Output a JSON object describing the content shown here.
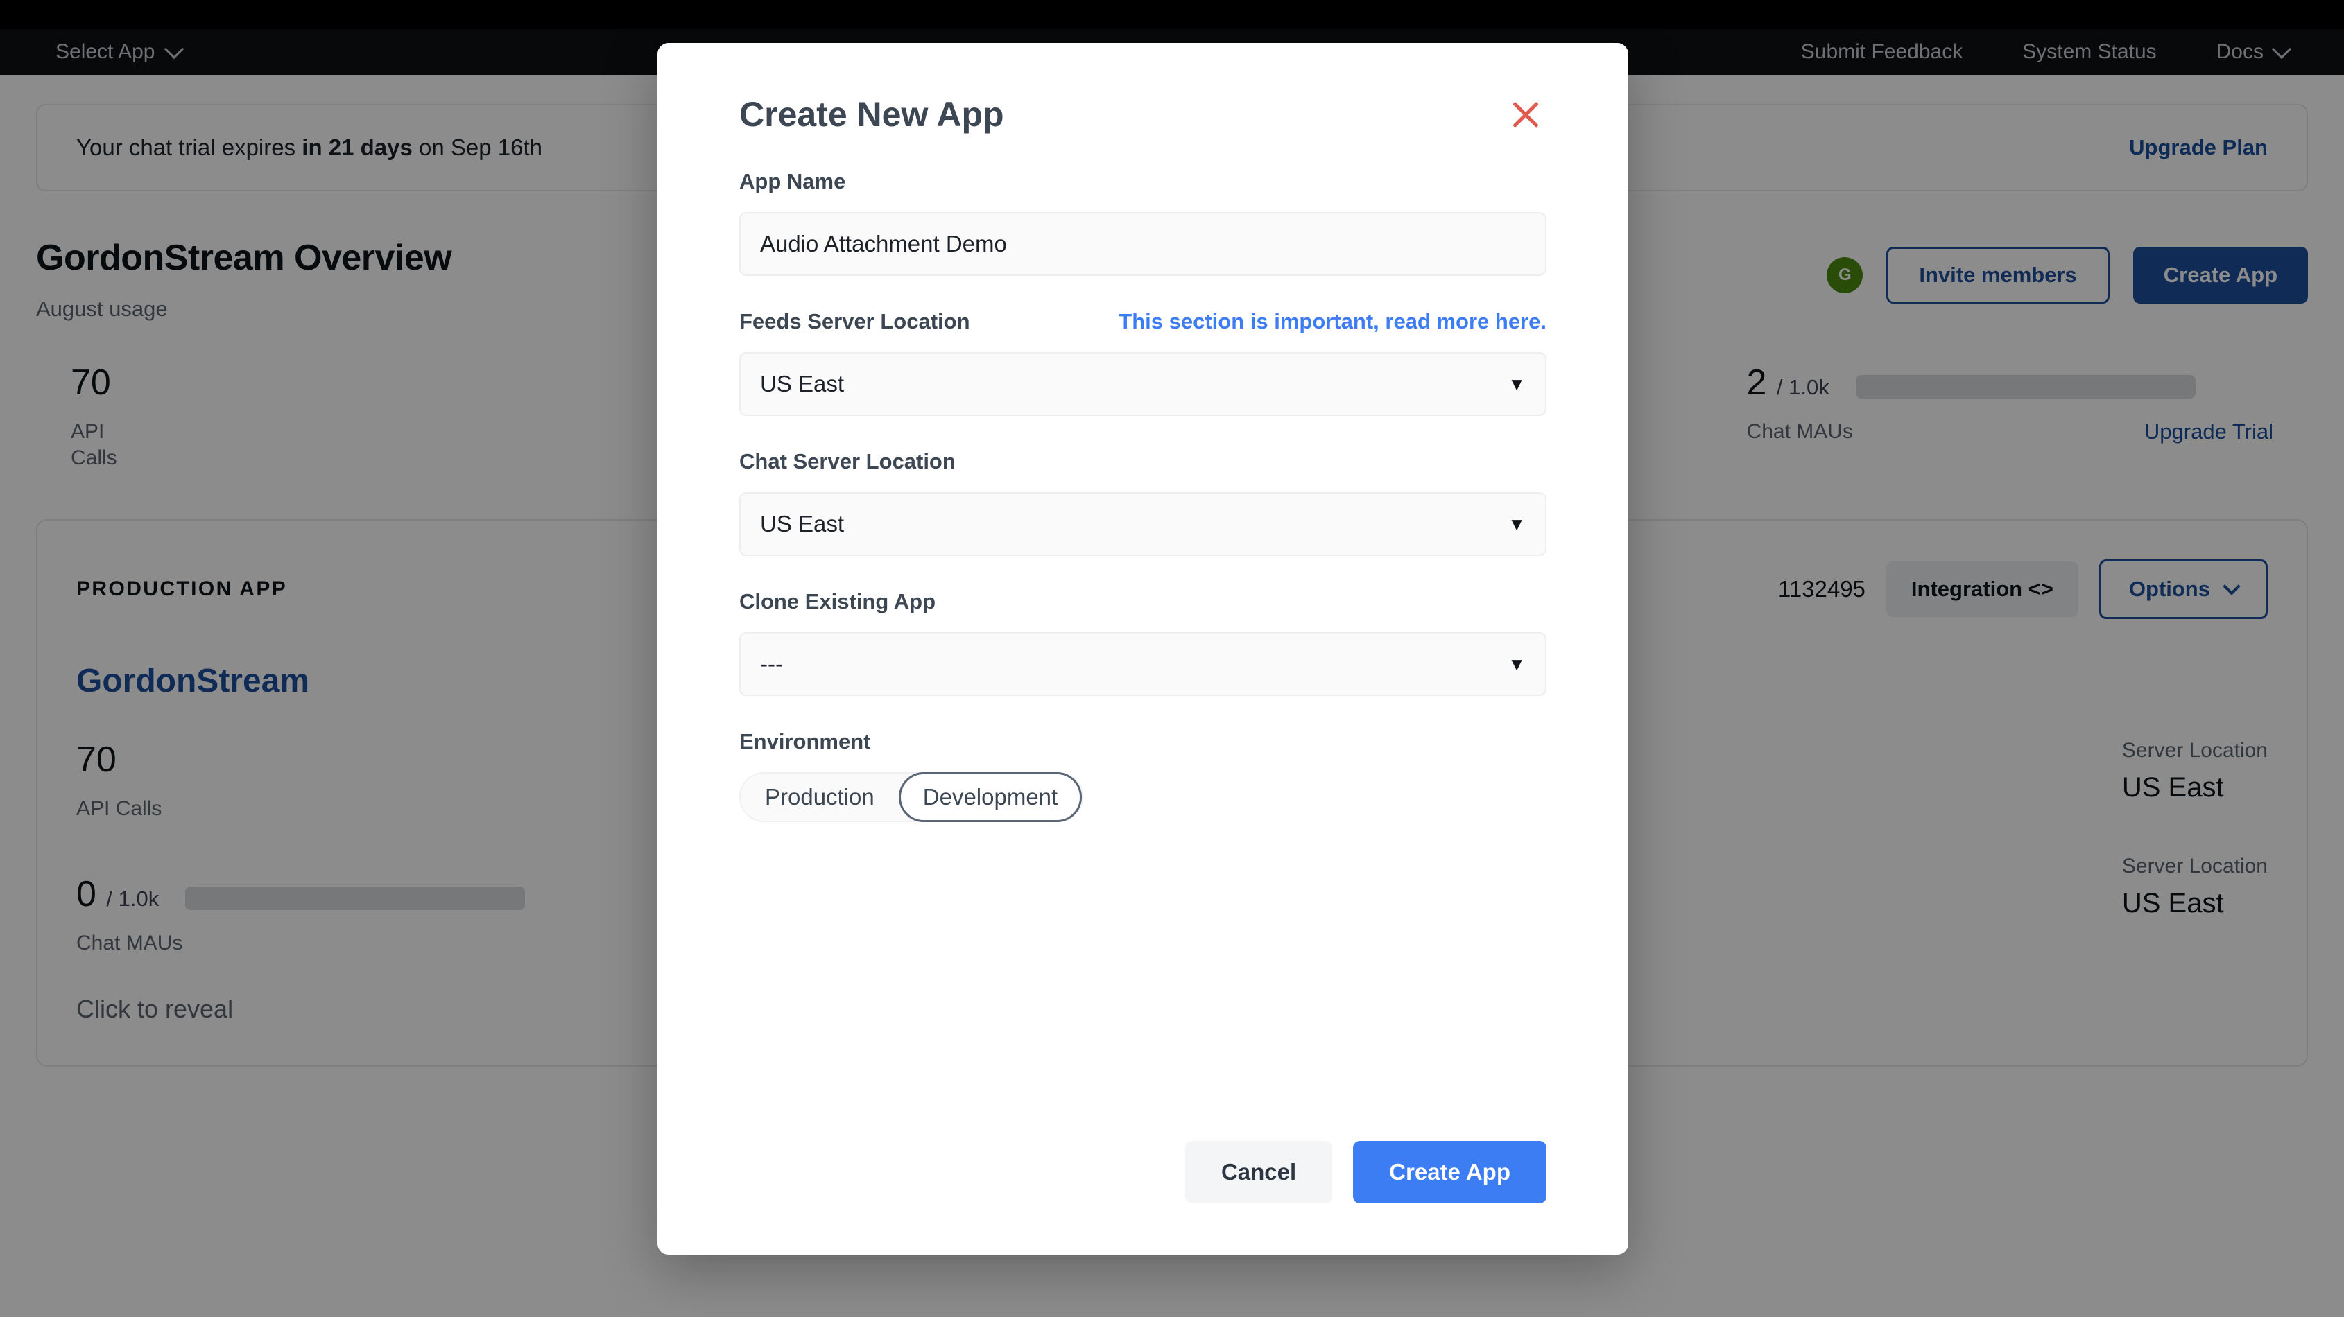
{
  "topbar": {
    "select_app_label": "Select App",
    "links": [
      {
        "label": "Submit Feedback",
        "has_caret": false
      },
      {
        "label": "System Status",
        "has_caret": false
      },
      {
        "label": "Docs",
        "has_caret": true
      }
    ]
  },
  "banner": {
    "text_before": "Your chat trial expires ",
    "text_bold": "in 21 days",
    "text_after": " on Sep 16th",
    "upgrade_label": "Upgrade Plan"
  },
  "overview": {
    "title": "GordonStream Overview",
    "subtitle": "August usage",
    "avatar_initial": "G",
    "invite_label": "Invite members",
    "create_app_label": "Create App",
    "stats": {
      "api_calls_value": "70",
      "api_calls_label_line1": "API",
      "api_calls_label_line2": "Calls",
      "chat_maus_value": "2",
      "chat_maus_denominator": "/ 1.0k",
      "chat_maus_label": "Chat MAUs",
      "upgrade_trial_label": "Upgrade Trial"
    }
  },
  "app_card": {
    "eyebrow": "PRODUCTION APP",
    "app_id": "1132495",
    "integration_label": "Integration <>",
    "options_label": "Options",
    "name": "GordonStream",
    "api_calls_value": "70",
    "api_calls_label": "API Calls",
    "chat_maus_value": "0",
    "chat_maus_denominator": "/ 1.0k",
    "chat_maus_label": "Chat MAUs",
    "secret_reveal": "Click to reveal",
    "server_location_label": "Server Location",
    "server_location_value": "US East",
    "server_location_label_2": "Server Location",
    "server_location_value_2": "US East"
  },
  "modal": {
    "title": "Create New App",
    "close_icon": "close-icon",
    "app_name": {
      "label": "App Name",
      "value": "Audio Attachment Demo",
      "placeholder": "App Name"
    },
    "feeds_server": {
      "label": "Feeds Server Location",
      "note": "This section is important, read more here.",
      "value": "US East"
    },
    "chat_server": {
      "label": "Chat Server Location",
      "value": "US East"
    },
    "clone_app": {
      "label": "Clone Existing App",
      "value": "---"
    },
    "environment": {
      "label": "Environment",
      "options": [
        "Production",
        "Development"
      ],
      "selected": "Development"
    },
    "cancel_label": "Cancel",
    "create_label": "Create App",
    "accent_color": "#3d7df3",
    "close_color": "#e05a4e"
  }
}
